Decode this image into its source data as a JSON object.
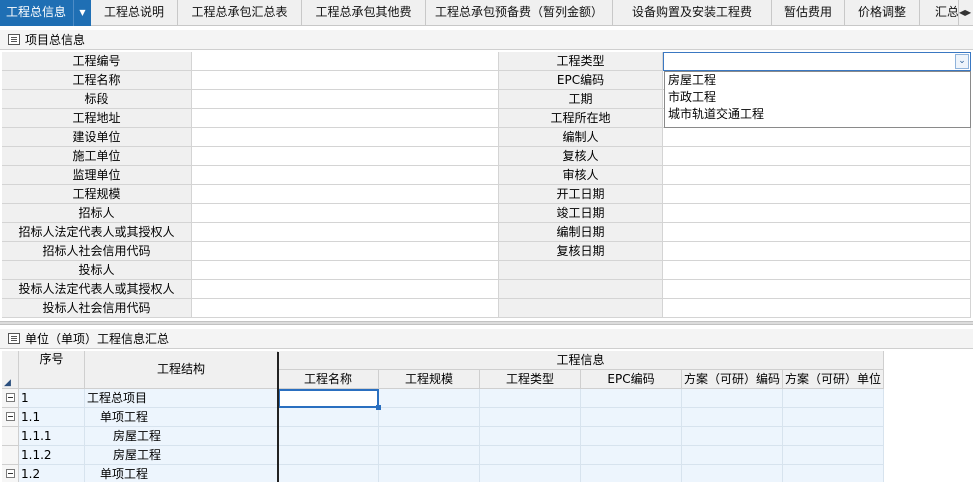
{
  "tabs": [
    {
      "label": "工程总信息",
      "active": true
    },
    {
      "label": "工程总说明"
    },
    {
      "label": "工程总承包汇总表"
    },
    {
      "label": "工程总承包其他费"
    },
    {
      "label": "工程总承包预备费（暂列金额）"
    },
    {
      "label": "设备购置及安装工程费"
    },
    {
      "label": "暂估费用"
    },
    {
      "label": "价格调整"
    },
    {
      "label": "汇总"
    }
  ],
  "tab_scroll": {
    "left": "◀",
    "right": "▶"
  },
  "active_tab_caret": "▼",
  "info_panel": {
    "title": "项目总信息",
    "rows": [
      {
        "label": "工程编号",
        "value": "",
        "label2": "工程类型",
        "value2": ""
      },
      {
        "label": "工程名称",
        "value": "",
        "label2": "EPC编码",
        "value2": ""
      },
      {
        "label": "标段",
        "value": "",
        "label2": "工期",
        "value2": ""
      },
      {
        "label": "工程地址",
        "value": "",
        "label2": "工程所在地",
        "value2": ""
      },
      {
        "label": "建设单位",
        "value": "",
        "label2": "编制人",
        "value2": ""
      },
      {
        "label": "施工单位",
        "value": "",
        "label2": "复核人",
        "value2": ""
      },
      {
        "label": "监理单位",
        "value": "",
        "label2": "审核人",
        "value2": ""
      },
      {
        "label": "工程规模",
        "value": "",
        "label2": "开工日期",
        "value2": ""
      },
      {
        "label": "招标人",
        "value": "",
        "label2": "竣工日期",
        "value2": ""
      },
      {
        "label": "招标人法定代表人或其授权人",
        "value": "",
        "label2": "编制日期",
        "value2": ""
      },
      {
        "label": "招标人社会信用代码",
        "value": "",
        "label2": "复核日期",
        "value2": ""
      },
      {
        "label": "投标人",
        "value": "",
        "label2": "",
        "value2": ""
      },
      {
        "label": "投标人法定代表人或其授权人",
        "value": "",
        "label2": "",
        "value2": ""
      },
      {
        "label": "投标人社会信用代码",
        "value": "",
        "label2": "",
        "value2": ""
      }
    ],
    "type_select": {
      "value": "",
      "button": "⌄",
      "options": [
        "房屋工程",
        "市政工程",
        "城市轨道交通工程"
      ]
    }
  },
  "unit_panel": {
    "title": "单位（单项）工程信息汇总",
    "headers": {
      "corner": "◢",
      "seq": "序号",
      "structure": "工程结构",
      "group": "工程信息",
      "cols": [
        "工程名称",
        "工程规模",
        "工程类型",
        "EPC编码",
        "方案（可研）编码",
        "方案（可研）单位"
      ]
    },
    "rows": [
      {
        "toggle": true,
        "seq": "1",
        "name": "工程总项目",
        "indent": 0
      },
      {
        "toggle": true,
        "seq": "1.1",
        "name": "单项工程",
        "indent": 1
      },
      {
        "toggle": false,
        "seq": "1.1.1",
        "name": "房屋工程",
        "indent": 2
      },
      {
        "toggle": false,
        "seq": "1.1.2",
        "name": "房屋工程",
        "indent": 2
      },
      {
        "toggle": true,
        "seq": "1.2",
        "name": "单项工程",
        "indent": 1
      }
    ]
  }
}
